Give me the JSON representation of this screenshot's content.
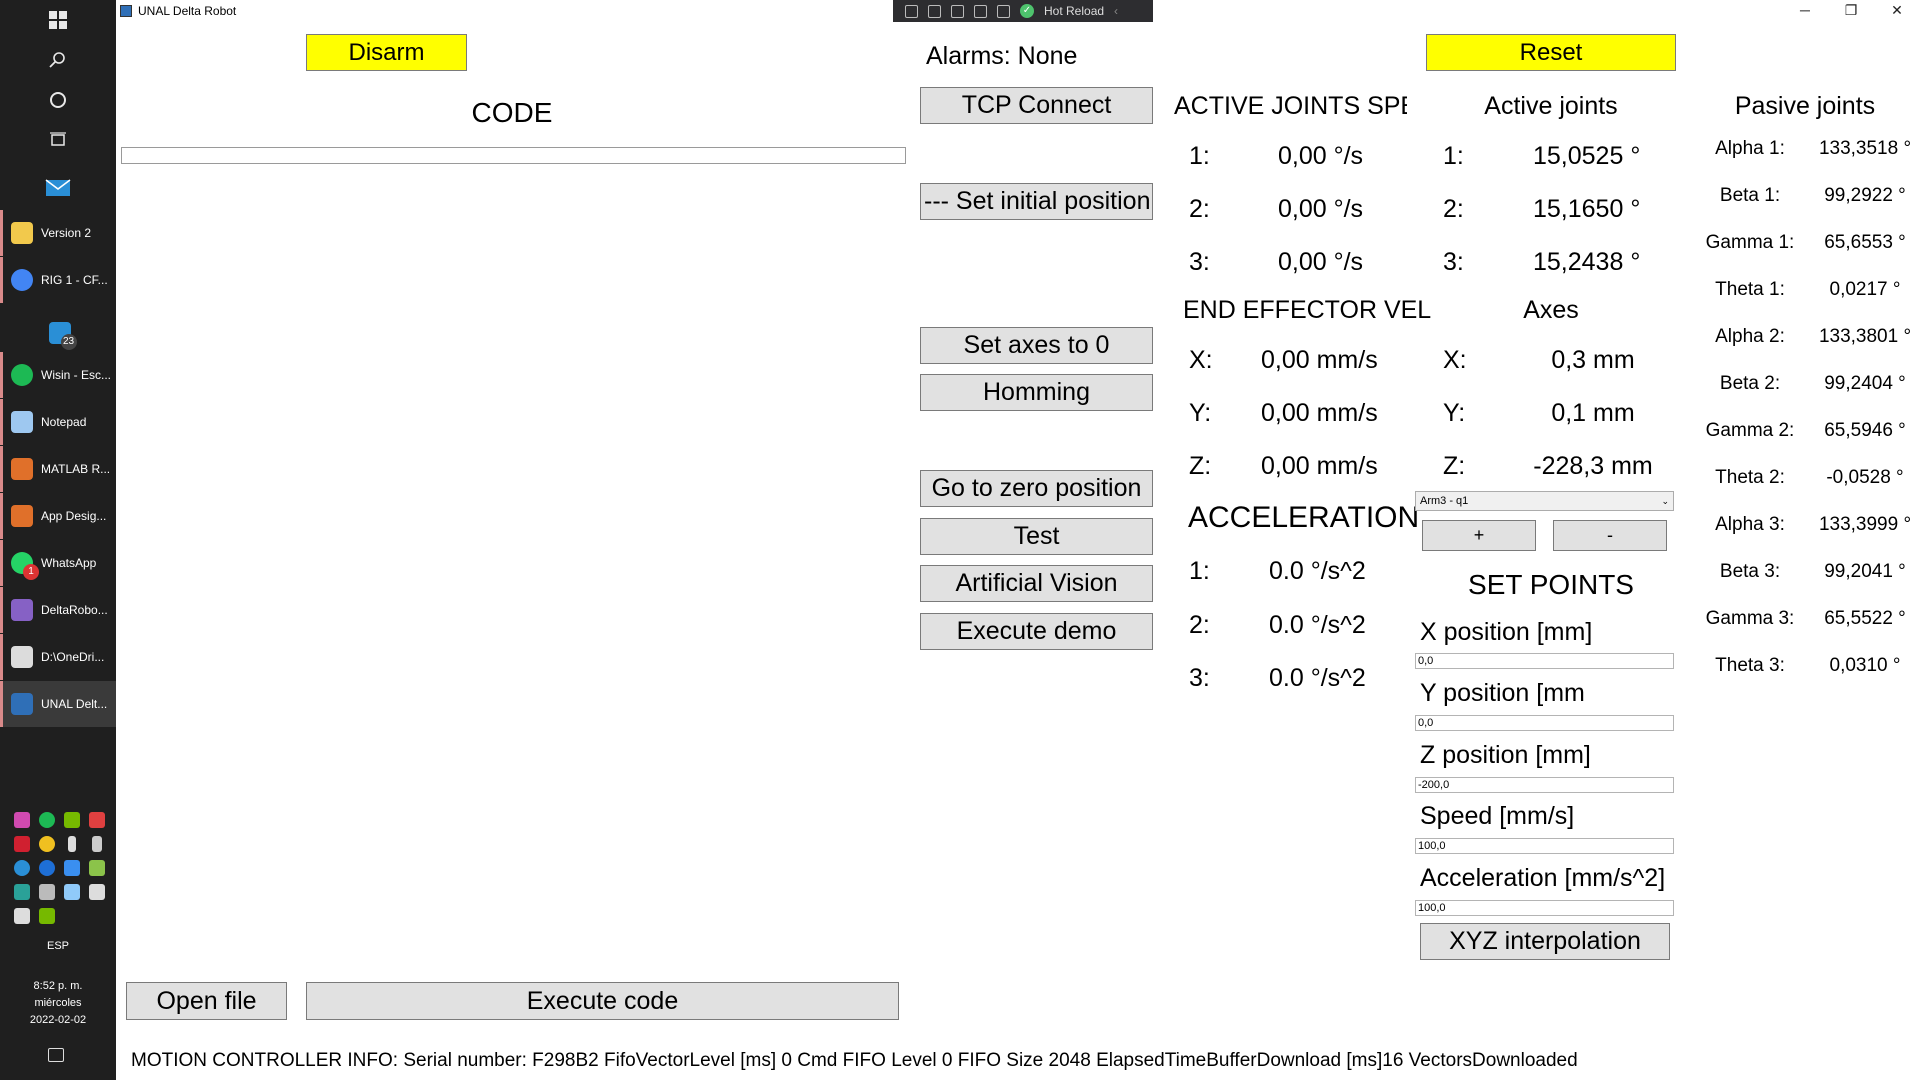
{
  "taskbar": {
    "apps": [
      {
        "label": "Version 2",
        "color": "#f2c94c"
      },
      {
        "label": "RIG 1 - CF...",
        "color": "#4285f4"
      },
      {
        "label": "",
        "color": "#2a8fd6",
        "badge": "23"
      },
      {
        "label": "Wisin - Esc...",
        "color": "#1db954"
      },
      {
        "label": "Notepad",
        "color": "#9ec8f0"
      },
      {
        "label": "MATLAB R...",
        "color": "#e0702a"
      },
      {
        "label": "App Desig...",
        "color": "#e0702a"
      },
      {
        "label": "WhatsApp",
        "color": "#25d366",
        "badge": "1"
      },
      {
        "label": "DeltaRobo...",
        "color": "#8661c5"
      },
      {
        "label": "D:\\OneDri...",
        "color": "#dcdcdc"
      },
      {
        "label": "UNAL Delt...",
        "color": "#2f6fb7"
      }
    ],
    "lang": "ESP",
    "time": "8:52 p. m.",
    "day": "miércoles",
    "date": "2022-02-02"
  },
  "window": {
    "title": "UNAL Delta Robot",
    "hot_reload": "Hot Reload"
  },
  "left": {
    "disarm": "Disarm",
    "code_title": "CODE",
    "code_value": "",
    "open_file": "Open file",
    "execute_code": "Execute code"
  },
  "middle": {
    "alarms": "Alarms: None",
    "tcp_connect": "TCP Connect",
    "set_initial": "--- Set initial position",
    "set_axes": "Set axes to 0",
    "homming": "Homming",
    "go_zero": "Go to zero position",
    "test": "Test",
    "vision": "Artificial Vision",
    "demo": "Execute demo"
  },
  "speeds": {
    "title": "ACTIVE JOINTS SPEED",
    "rows": [
      {
        "label": "1:",
        "value": "0,00 °/s"
      },
      {
        "label": "2:",
        "value": "0,00 °/s"
      },
      {
        "label": "3:",
        "value": "0,00 °/s"
      }
    ]
  },
  "end_effector": {
    "title": "END EFFECTOR VEL",
    "rows": [
      {
        "label": "X:",
        "value": "0,00 mm/s"
      },
      {
        "label": "Y:",
        "value": "0,00 mm/s"
      },
      {
        "label": "Z:",
        "value": "0,00 mm/s"
      }
    ]
  },
  "acceleration": {
    "title": "ACCELERATION",
    "rows": [
      {
        "label": "1:",
        "value": "0.0 °/s^2"
      },
      {
        "label": "2:",
        "value": "0.0 °/s^2"
      },
      {
        "label": "3:",
        "value": "0.0 °/s^2"
      }
    ]
  },
  "right": {
    "reset": "Reset",
    "active_title": "Active joints",
    "active_rows": [
      {
        "label": "1:",
        "value": "15,0525 °"
      },
      {
        "label": "2:",
        "value": "15,1650 °"
      },
      {
        "label": "3:",
        "value": "15,2438 °"
      }
    ],
    "axes_title": "Axes",
    "axes_rows": [
      {
        "label": "X:",
        "value": "0,3 mm"
      },
      {
        "label": "Y:",
        "value": "0,1 mm"
      },
      {
        "label": "Z:",
        "value": "-228,3 mm"
      }
    ],
    "combo_value": "Arm3 - q1",
    "plus": "+",
    "minus": "-",
    "setpoints_title": "SET POINTS",
    "fields": [
      {
        "label": "X position [mm]",
        "value": "0,0"
      },
      {
        "label": "Y position [mm",
        "value": "0,0"
      },
      {
        "label": "Z position [mm]",
        "value": "-200,0"
      },
      {
        "label": "Speed [mm/s]",
        "value": "100,0"
      },
      {
        "label": "Acceleration [mm/s^2]",
        "value": "100,0"
      }
    ],
    "xyz_interp": "XYZ interpolation"
  },
  "passive": {
    "title": "Pasive joints",
    "rows": [
      {
        "label": "Alpha 1:",
        "value": "133,3518 °"
      },
      {
        "label": "Beta 1:",
        "value": "99,2922 °"
      },
      {
        "label": "Gamma 1:",
        "value": "65,6553 °"
      },
      {
        "label": "Theta 1:",
        "value": "0,0217 °"
      },
      {
        "label": "Alpha 2:",
        "value": "133,3801 °"
      },
      {
        "label": "Beta 2:",
        "value": "99,2404 °"
      },
      {
        "label": "Gamma 2:",
        "value": "65,5946 °"
      },
      {
        "label": "Theta 2:",
        "value": "-0,0528 °"
      },
      {
        "label": "Alpha 3:",
        "value": "133,3999 °"
      },
      {
        "label": "Beta 3:",
        "value": "99,2041 °"
      },
      {
        "label": "Gamma 3:",
        "value": "65,5522 °"
      },
      {
        "label": "Theta 3:",
        "value": "0,0310 °"
      }
    ]
  },
  "info_bar": "MOTION CONTROLLER INFO:    Serial number: F298B2    FifoVectorLevel [ms] 0    Cmd FIFO Level 0    FIFO Size 2048    ElapsedTimeBufferDownload [ms]16    VectorsDownloaded"
}
